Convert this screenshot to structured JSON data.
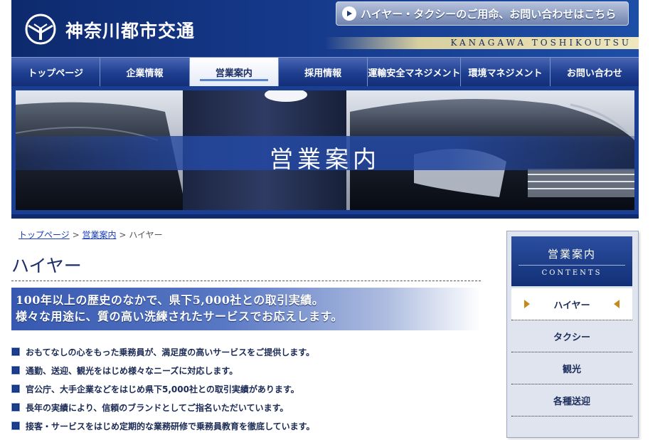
{
  "header": {
    "logo_text": "神奈川都市交通",
    "brand_en": "KANAGAWA TOSHIKOUTSU",
    "inquiry_label": "ハイヤー・タクシーのご用命、お問い合わせはこちら"
  },
  "nav": {
    "items": [
      {
        "label": "トップページ"
      },
      {
        "label": "企業情報"
      },
      {
        "label": "営業案内"
      },
      {
        "label": "採用情報"
      },
      {
        "label": "運輸安全マネジメント"
      },
      {
        "label": "環境マネジメント"
      },
      {
        "label": "お問い合わせ"
      }
    ],
    "active": "営業案内"
  },
  "hero": {
    "title": "営業案内"
  },
  "breadcrumb": {
    "links": [
      "トップページ",
      "営業案内"
    ],
    "separator": ">",
    "current": "ハイヤー"
  },
  "main": {
    "title": "ハイヤー",
    "lead_line1": "100年以上の歴史のなかで、県下5,000社との取引実績。",
    "lead_line2": "様々な用途に、質の高い洗練されたサービスでお応えします。",
    "bullets": [
      "おもてなしの心をもった乗務員が、満足度の高いサービスをご提供します。",
      "通勤、送迎、観光をはじめ様々なニーズに対応します。",
      "官公庁、大手企業などをはじめ県下5,000社との取引実績があります。",
      "長年の実績により、信頼のブランドとしてご指名いただいています。",
      "接客・サービスをはじめ定期的な業務研修で乗務員教育を徹底しています。"
    ]
  },
  "sidebar": {
    "title": "営業案内",
    "subtitle": "CONTENTS",
    "items": [
      "ハイヤー",
      "タクシー",
      "観光",
      "各種送迎"
    ],
    "active": "ハイヤー"
  },
  "colors": {
    "brand_navy": "#16398a",
    "accent_gold": "#c58a1b",
    "link_blue": "#1a3cb8"
  },
  "icons": [
    "logo-emblem-icon",
    "play-circle-icon",
    "bullet-square-icon",
    "triangle-right-icon",
    "triangle-left-icon"
  ]
}
